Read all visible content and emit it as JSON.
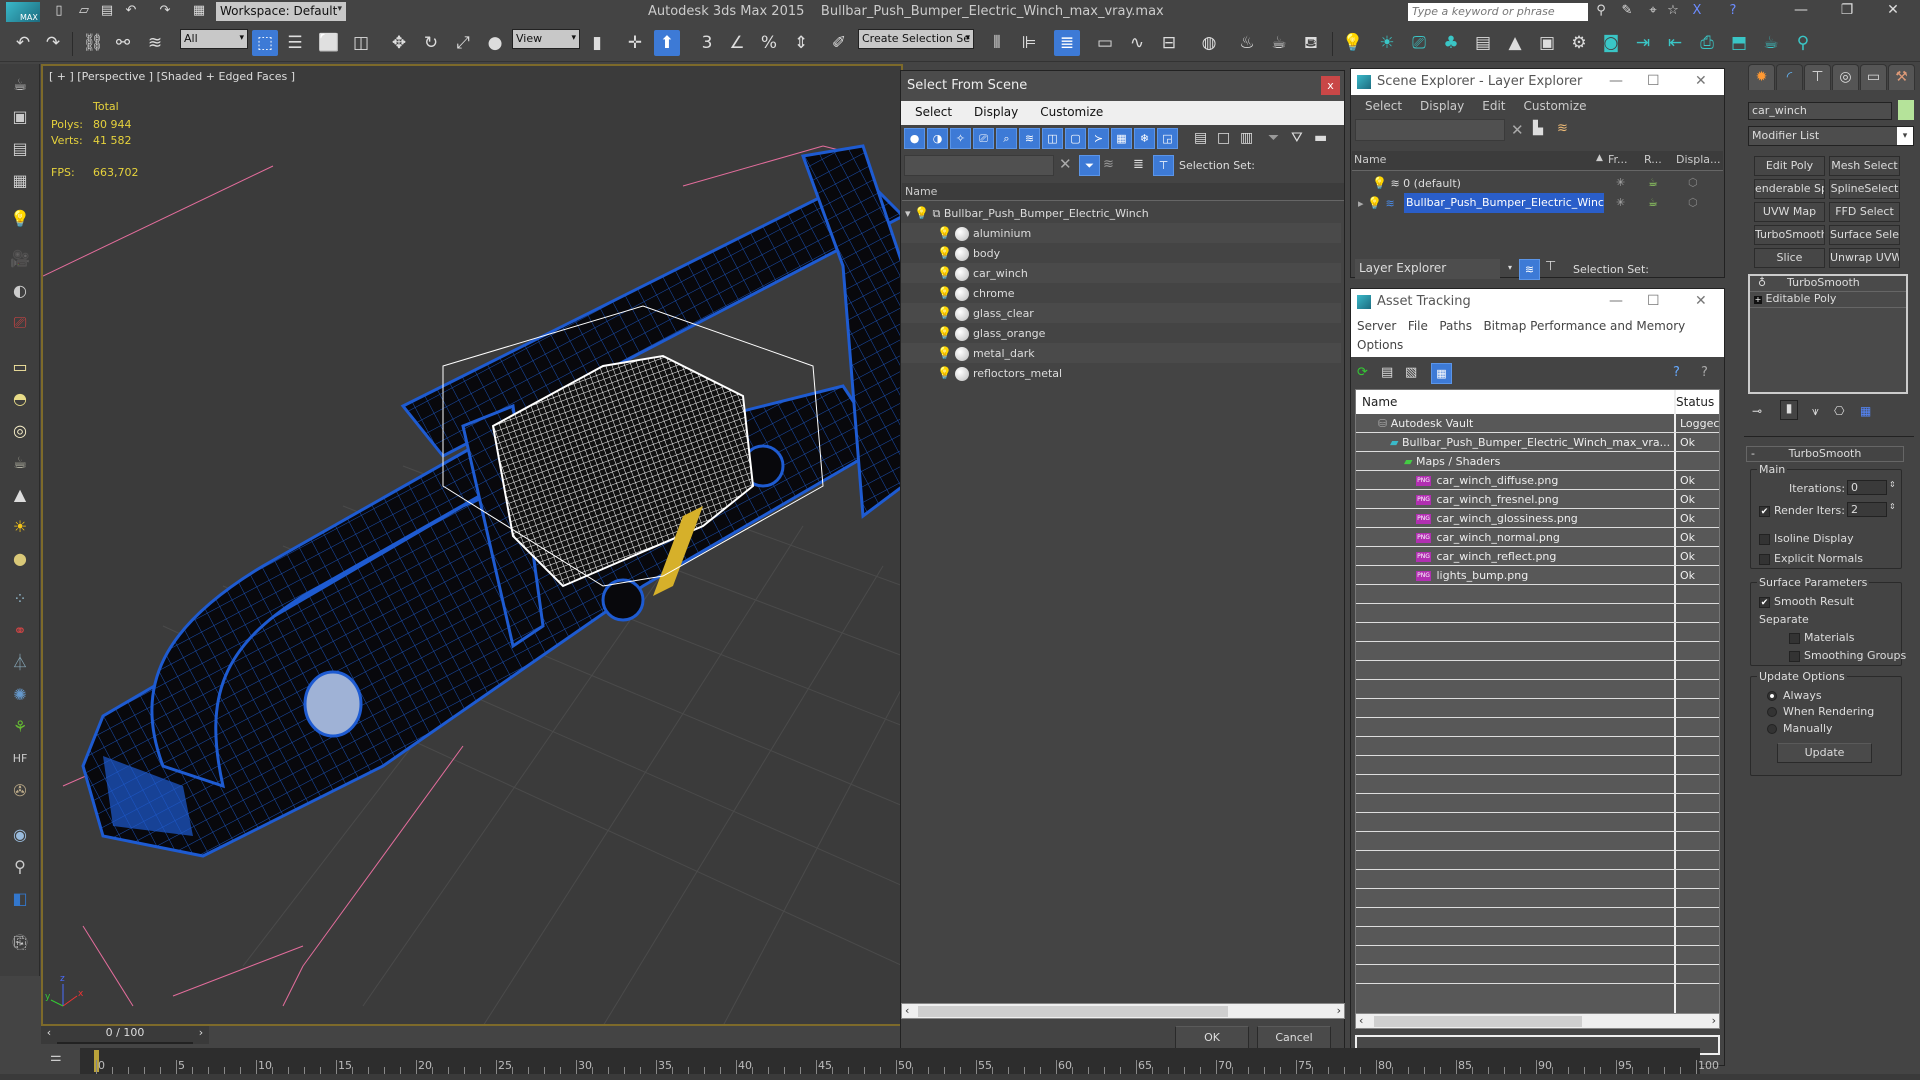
{
  "app": {
    "title": "Autodesk 3ds Max  2015",
    "file": "Bullbar_Push_Bumper_Electric_Winch_max_vray.max",
    "logo": "MAX",
    "workspace": "Workspace: Default",
    "search_placeholder": "Type a keyword or phrase"
  },
  "toolbar": {
    "filter": "All",
    "coord": "View",
    "selection_set": "Create Selection Se"
  },
  "viewport": {
    "label": "[ + ] [Perspective ] [Shaded + Edged Faces ]",
    "stats": {
      "total_label": "Total",
      "polys_label": "Polys:",
      "polys": "80 944",
      "verts_label": "Verts:",
      "verts": "41 582",
      "fps_label": "FPS:",
      "fps": "663,702"
    }
  },
  "select_from_scene": {
    "title": "Select From Scene",
    "close": "x",
    "menu": [
      "Select",
      "Display",
      "Customize"
    ],
    "selection_set_label": "Selection Set:",
    "column": "Name",
    "root": "Bullbar_Push_Bumper_Electric_Winch",
    "items": [
      "aluminium",
      "body",
      "car_winch",
      "chrome",
      "glass_clear",
      "glass_orange",
      "metal_dark",
      "refloctors_metal"
    ],
    "ok": "OK",
    "cancel": "Cancel"
  },
  "scene_explorer": {
    "title": "Scene Explorer - Layer Explorer",
    "menu": [
      "Select",
      "Display",
      "Edit",
      "Customize"
    ],
    "columns": [
      "Name",
      "Fr...",
      "R...",
      "Displa..."
    ],
    "layers": [
      "0 (default)",
      "Bullbar_Push_Bumper_Electric_Winch"
    ],
    "footer_mode": "Layer Explorer",
    "selection_set_label": "Selection Set:"
  },
  "asset_tracking": {
    "title": "Asset Tracking",
    "menu": [
      "Server",
      "File",
      "Paths",
      "Bitmap Performance and Memory",
      "Options"
    ],
    "columns": [
      "Name",
      "Status"
    ],
    "rows": [
      {
        "name": "Autodesk Vault",
        "status": "Loggec"
      },
      {
        "name": "Bullbar_Push_Bumper_Electric_Winch_max_vra...",
        "status": "Ok"
      },
      {
        "name": "Maps / Shaders",
        "status": ""
      },
      {
        "name": "car_winch_diffuse.png",
        "status": "Ok"
      },
      {
        "name": "car_winch_fresnel.png",
        "status": "Ok"
      },
      {
        "name": "car_winch_glossiness.png",
        "status": "Ok"
      },
      {
        "name": "car_winch_normal.png",
        "status": "Ok"
      },
      {
        "name": "car_winch_reflect.png",
        "status": "Ok"
      },
      {
        "name": "lights_bump.png",
        "status": "Ok"
      }
    ]
  },
  "command_panel": {
    "object_name": "car_winch",
    "object_color": "#b5e39a",
    "modifier_list": "Modifier List",
    "modifier_buttons": [
      "Edit Poly",
      "Mesh Select",
      "enderable Splir",
      "SplineSelect",
      "UVW Map",
      "FFD Select",
      "TurboSmooth",
      "Surface Select",
      "Slice",
      "Unwrap UVW"
    ],
    "stack": [
      "TurboSmooth",
      "Editable Poly"
    ],
    "rollout": "TurboSmooth",
    "main_label": "Main",
    "iterations_label": "Iterations:",
    "iterations": "0",
    "render_iters_label": "Render Iters:",
    "render_iters": "2",
    "render_iters_checked": true,
    "isoline": "Isoline Display",
    "explicit_normals": "Explicit Normals",
    "surface_label": "Surface Parameters",
    "smooth_result": "Smooth Result",
    "separate": "Separate",
    "materials": "Materials",
    "smoothing_groups": "Smoothing Groups",
    "update_label": "Update Options",
    "always": "Always",
    "when_rendering": "When Rendering",
    "manually": "Manually",
    "update": "Update"
  },
  "timeline": {
    "frame": "0 / 100",
    "ticks": [
      "0",
      "5",
      "10",
      "15",
      "20",
      "25",
      "30",
      "35",
      "40",
      "45",
      "50",
      "55",
      "60",
      "65",
      "70",
      "75",
      "80",
      "85",
      "90",
      "95",
      "100"
    ]
  },
  "colors": {
    "accent": "#3d7ad6",
    "viewport_border": "#7d6a2a",
    "stats": "#e6d23c",
    "close": "#c94747"
  }
}
